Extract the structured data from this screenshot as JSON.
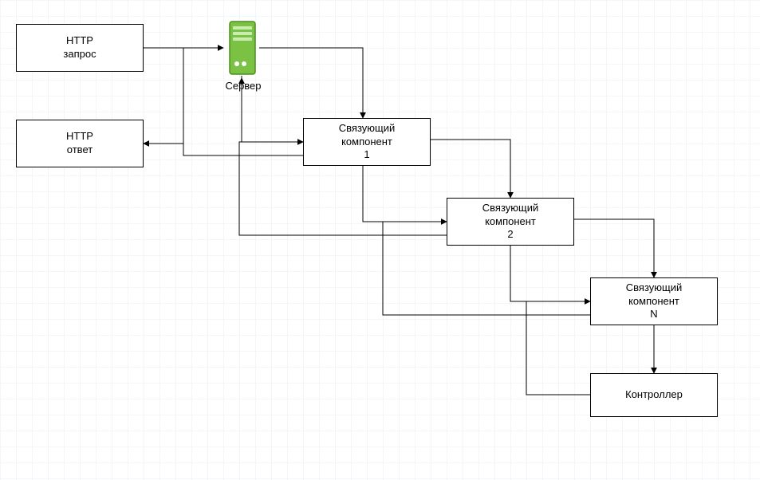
{
  "nodes": {
    "http_request": "HTTP\nзапрос",
    "http_response": "HTTP\nответ",
    "server_label": "Сервер",
    "mw1": "Связующий\nкомпонент\n1",
    "mw2": "Связующий\nкомпонент\n2",
    "mwN": "Связующий\nкомпонент\nN",
    "controller": "Контроллер"
  },
  "icons": {
    "server": "server-icon"
  }
}
